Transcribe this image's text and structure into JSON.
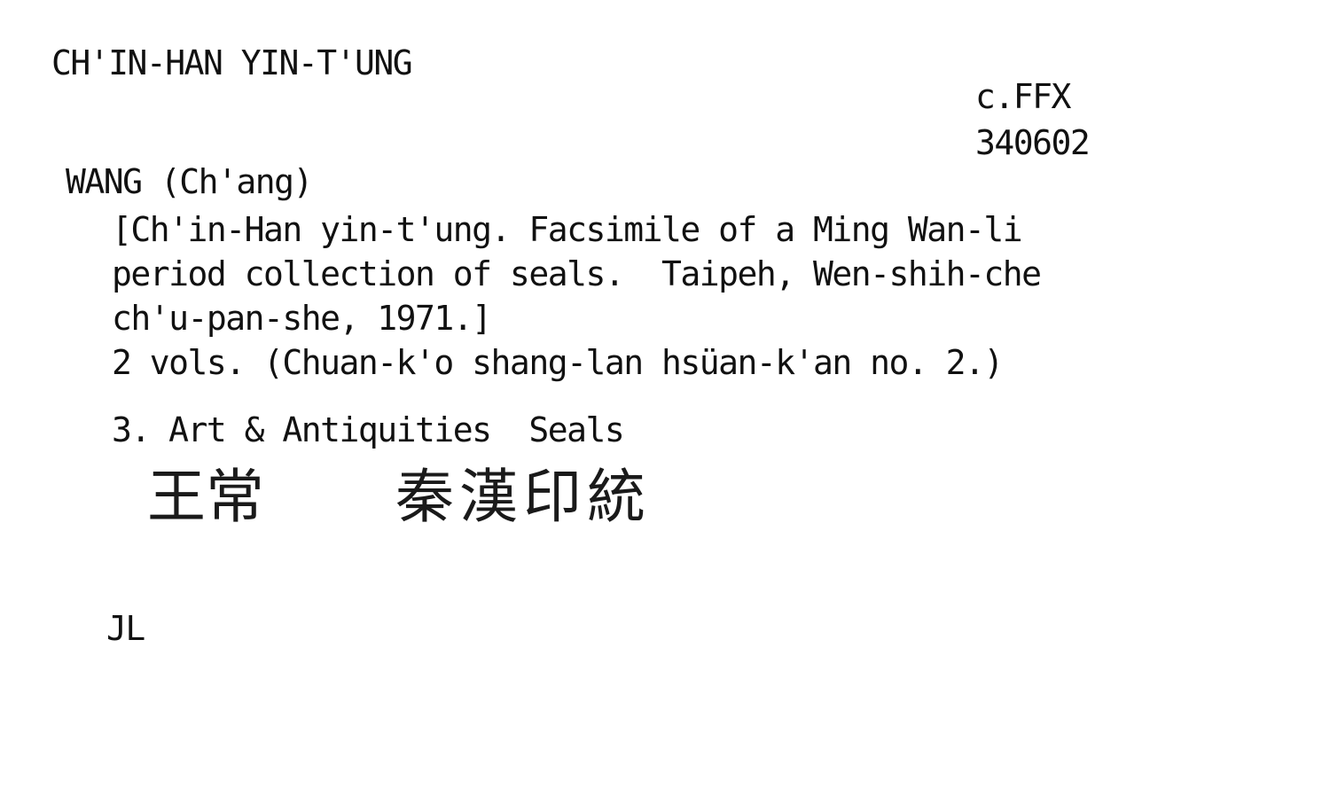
{
  "card": {
    "heading": "CH'IN-HAN YIN-T'UNG",
    "call_number": [
      "c.FFX",
      "340602"
    ],
    "author": "WANG (Ch'ang)",
    "description": [
      "[Ch'in-Han yin-t'ung. Facsimile of a Ming Wan-li",
      "period collection of seals.  Taipeh, Wen-shih-che",
      "ch'u-pan-she, 1971.]",
      "2 vols. (Chuan-k'o shang-lan hsüan-k'an no. 2.)"
    ],
    "subject": "3. Art & Antiquities  Seals",
    "handwritten_author": "王常",
    "handwritten_title": "秦漢印統",
    "initials": "JL"
  }
}
